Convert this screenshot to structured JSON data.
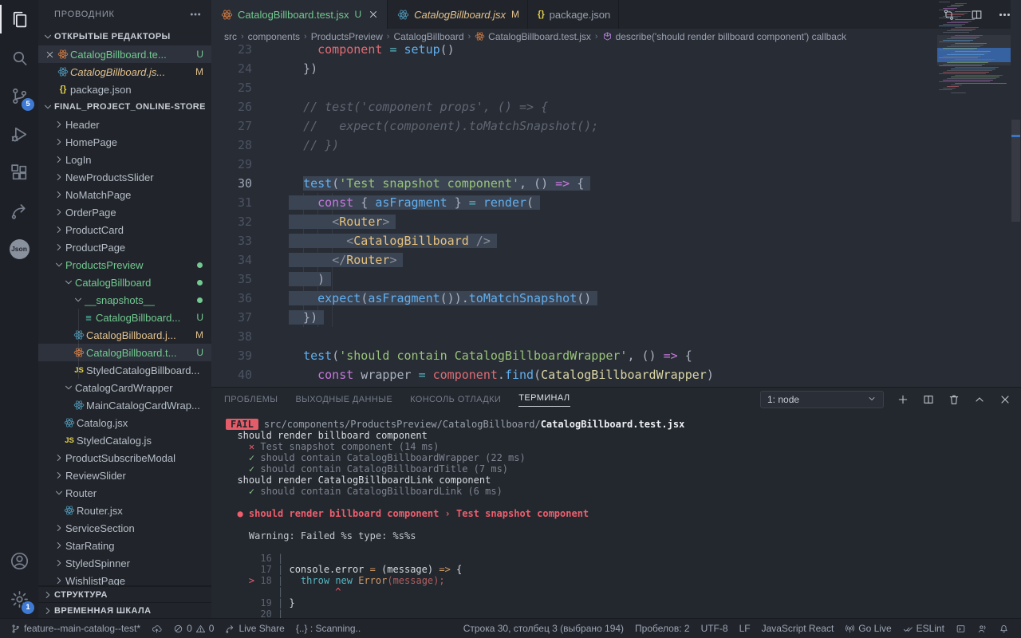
{
  "theme": {
    "accent_blue": "#3e7ad3",
    "git_added_green": "#73c991",
    "git_modified_yellow": "#e2c08d",
    "error_red": "#e45c68",
    "selection": "#3b4453"
  },
  "activity_bar": {
    "items": [
      {
        "name": "explorer",
        "active": true
      },
      {
        "name": "search"
      },
      {
        "name": "source-control",
        "badge": "5"
      },
      {
        "name": "run-debug"
      },
      {
        "name": "extensions"
      },
      {
        "name": "live-share"
      },
      {
        "name": "json-extension",
        "text": "Json"
      }
    ],
    "bottom": [
      {
        "name": "account"
      },
      {
        "name": "settings",
        "badge": "1"
      }
    ]
  },
  "sidebar": {
    "title": "ПРОВОДНИК",
    "sections": {
      "open_editors": "ОТКРЫТЫЕ РЕДАКТОРЫ",
      "workspace": "FINAL_PROJECT_ONLINE-STORE",
      "outline": "СТРУКТУРА",
      "timeline": "ВРЕМЕННАЯ ШКАЛА"
    },
    "open_editors": [
      {
        "label": "CatalogBillboard.te...",
        "icon": "react-orange",
        "color": "green",
        "badge": "U",
        "selected": true,
        "close": true
      },
      {
        "label": "CatalogBillboard.js...",
        "icon": "react-blue",
        "color": "modified",
        "italic": true,
        "badge": "M"
      },
      {
        "label": "package.json",
        "icon": "braces",
        "color": "normal"
      }
    ],
    "tree": [
      {
        "label": "Header",
        "depth": 0,
        "chevron": "right"
      },
      {
        "label": "HomePage",
        "depth": 0,
        "chevron": "right"
      },
      {
        "label": "LogIn",
        "depth": 0,
        "chevron": "right"
      },
      {
        "label": "NewProductsSlider",
        "depth": 0,
        "chevron": "right"
      },
      {
        "label": "NoMatchPage",
        "depth": 0,
        "chevron": "right"
      },
      {
        "label": "OrderPage",
        "depth": 0,
        "chevron": "right"
      },
      {
        "label": "ProductCard",
        "depth": 0,
        "chevron": "right"
      },
      {
        "label": "ProductPage",
        "depth": 0,
        "chevron": "right"
      },
      {
        "label": "ProductsPreview",
        "depth": 0,
        "chevron": "down",
        "color": "green",
        "dot": true
      },
      {
        "label": "CatalogBillboard",
        "depth": 1,
        "chevron": "down",
        "color": "green",
        "dot": true
      },
      {
        "label": "__snapshots__",
        "depth": 2,
        "chevron": "down",
        "color": "green",
        "dot": true
      },
      {
        "label": "CatalogBillboard...",
        "depth": 3,
        "icon": "snap",
        "color": "green",
        "badge": "U"
      },
      {
        "label": "CatalogBillboard.j...",
        "depth": 2,
        "icon": "react-blue",
        "color": "modified",
        "badge": "M"
      },
      {
        "label": "CatalogBillboard.t...",
        "depth": 2,
        "icon": "react-orange",
        "color": "green",
        "badge": "U",
        "selected": true
      },
      {
        "label": "StyledCatalogBillboard...",
        "depth": 2,
        "icon": "js"
      },
      {
        "label": "CatalogCardWrapper",
        "depth": 1,
        "chevron": "down"
      },
      {
        "label": "MainCatalogCardWrap...",
        "depth": 2,
        "icon": "react-blue"
      },
      {
        "label": "Catalog.jsx",
        "depth": 1,
        "icon": "react-blue"
      },
      {
        "label": "StyledCatalog.js",
        "depth": 1,
        "icon": "js"
      },
      {
        "label": "ProductSubscribeModal",
        "depth": 0,
        "chevron": "right"
      },
      {
        "label": "ReviewSlider",
        "depth": 0,
        "chevron": "right"
      },
      {
        "label": "Router",
        "depth": 0,
        "chevron": "down"
      },
      {
        "label": "Router.jsx",
        "depth": 1,
        "icon": "react-blue"
      },
      {
        "label": "ServiceSection",
        "depth": 0,
        "chevron": "right"
      },
      {
        "label": "StarRating",
        "depth": 0,
        "chevron": "right"
      },
      {
        "label": "StyledSpinner",
        "depth": 0,
        "chevron": "right"
      },
      {
        "label": "WishlistPage",
        "depth": 0,
        "chevron": "right"
      }
    ]
  },
  "tabs": [
    {
      "label": "CatalogBillboard.test.jsx",
      "icon": "react-orange",
      "color": "#73c991",
      "badge": "U",
      "badge_color": "#73c991",
      "active": true,
      "close": true
    },
    {
      "label": "CatalogBillboard.jsx",
      "icon": "react-blue",
      "color": "#e2c08d",
      "badge": "M",
      "badge_color": "#e2c08d",
      "italic": true
    },
    {
      "label": "package.json",
      "icon": "braces",
      "color": "#99a0ad"
    }
  ],
  "editor_actions": [
    "git-compare",
    "split-editor",
    "more"
  ],
  "breadcrumbs": {
    "path": [
      "src",
      "components",
      "ProductsPreview",
      "CatalogBillboard"
    ],
    "file": {
      "icon": "react-orange",
      "label": "CatalogBillboard.test.jsx"
    },
    "symbol": {
      "icon": "symbol-namespace",
      "label": "describe('should render billboard component') callback"
    }
  },
  "editor": {
    "cursor_line": 30,
    "lines": [
      {
        "n": 23,
        "tokens": [
          [
            "    ",
            "d"
          ],
          [
            "component",
            "v"
          ],
          [
            " ",
            "d"
          ],
          [
            "=",
            "o"
          ],
          [
            " ",
            "d"
          ],
          [
            "setup",
            "f"
          ],
          [
            "()",
            "d"
          ]
        ]
      },
      {
        "n": 24,
        "tokens": [
          [
            "  })",
            "d"
          ]
        ]
      },
      {
        "n": 25,
        "tokens": []
      },
      {
        "n": 26,
        "tokens": [
          [
            "  ",
            "d"
          ],
          [
            "// test('component props', () => {",
            "c"
          ]
        ]
      },
      {
        "n": 27,
        "tokens": [
          [
            "  ",
            "d"
          ],
          [
            "//   expect(component).toMatchSnapshot();",
            "c"
          ]
        ]
      },
      {
        "n": 28,
        "tokens": [
          [
            "  ",
            "d"
          ],
          [
            "// })",
            "c"
          ]
        ]
      },
      {
        "n": 29,
        "tokens": []
      },
      {
        "n": 30,
        "sel": 2,
        "cursor": true,
        "tokens": [
          [
            "  ",
            "d"
          ],
          [
            "test",
            "f"
          ],
          [
            "(",
            "d"
          ],
          [
            "'Test snapshot component'",
            "s"
          ],
          [
            ", () ",
            "d"
          ],
          [
            "=>",
            "k"
          ],
          [
            " {",
            "d"
          ]
        ]
      },
      {
        "n": 31,
        "sel": 0,
        "tokens": [
          [
            "    ",
            "d"
          ],
          [
            "const",
            "k"
          ],
          [
            " { ",
            "d"
          ],
          [
            "asFragment",
            "f"
          ],
          [
            " } ",
            "d"
          ],
          [
            "=",
            "o"
          ],
          [
            " ",
            "d"
          ],
          [
            "render",
            "f"
          ],
          [
            "(",
            "d"
          ]
        ]
      },
      {
        "n": 32,
        "sel": 0,
        "tokens": [
          [
            "      ",
            "d"
          ],
          [
            "<",
            "p"
          ],
          [
            "Router",
            "t"
          ],
          [
            ">",
            "p"
          ]
        ]
      },
      {
        "n": 33,
        "sel": 0,
        "tokens": [
          [
            "        ",
            "d"
          ],
          [
            "<",
            "p"
          ],
          [
            "CatalogBillboard",
            "t"
          ],
          [
            " />",
            "p"
          ]
        ]
      },
      {
        "n": 34,
        "sel": 0,
        "tokens": [
          [
            "      ",
            "d"
          ],
          [
            "</",
            "p"
          ],
          [
            "Router",
            "t"
          ],
          [
            ">",
            "p"
          ]
        ]
      },
      {
        "n": 35,
        "sel": 0,
        "tokens": [
          [
            "    )",
            "d"
          ]
        ]
      },
      {
        "n": 36,
        "sel": 0,
        "tokens": [
          [
            "    ",
            "d"
          ],
          [
            "expect",
            "f"
          ],
          [
            "(",
            "d"
          ],
          [
            "asFragment",
            "f"
          ],
          [
            "()).",
            "d"
          ],
          [
            "toMatchSnapshot",
            "f"
          ],
          [
            "()",
            "d"
          ]
        ]
      },
      {
        "n": 37,
        "sel": 0,
        "tokens": [
          [
            "  })",
            "d"
          ]
        ]
      },
      {
        "n": 38,
        "tokens": []
      },
      {
        "n": 39,
        "tokens": [
          [
            "  ",
            "d"
          ],
          [
            "test",
            "f"
          ],
          [
            "(",
            "d"
          ],
          [
            "'should contain CatalogBillboardWrapper'",
            "s"
          ],
          [
            ", () ",
            "d"
          ],
          [
            "=>",
            "k"
          ],
          [
            " {",
            "d"
          ]
        ]
      },
      {
        "n": 40,
        "tokens": [
          [
            "    ",
            "d"
          ],
          [
            "const",
            "k"
          ],
          [
            " wrapper ",
            "d"
          ],
          [
            "=",
            "o"
          ],
          [
            " ",
            "d"
          ],
          [
            "component",
            "v"
          ],
          [
            ".",
            "d"
          ],
          [
            "find",
            "f"
          ],
          [
            "(",
            "d"
          ],
          [
            "CatalogBillboardWrapper",
            "n"
          ],
          [
            ")",
            "d"
          ]
        ]
      }
    ]
  },
  "minimap": {
    "total_rows": 58,
    "selection_rows": [
      29,
      37
    ],
    "viewport_rows": [
      21,
      39
    ]
  },
  "panel": {
    "tabs": [
      "ПРОБЛЕМЫ",
      "ВЫХОДНЫЕ ДАННЫЕ",
      "КОНСОЛЬ ОТЛАДКИ",
      "ТЕРМИНАЛ"
    ],
    "active_tab": "ТЕРМИНАЛ",
    "dropdown": "1: node",
    "actions": [
      "plus",
      "split-editor",
      "trash",
      "chevron-up",
      "close"
    ],
    "lines": [
      {
        "tokens": [
          [
            "FAIL",
            "badge"
          ],
          [
            "src/components/ProductsPreview/CatalogBillboard/",
            "g"
          ],
          [
            "CatalogBillboard.test.jsx",
            "b"
          ]
        ]
      },
      {
        "tokens": [
          [
            "  should render billboard component",
            "w"
          ]
        ]
      },
      {
        "tokens": [
          [
            "    ",
            "w"
          ],
          [
            "✕",
            "r"
          ],
          [
            " Test snapshot component (14 ms)",
            "dim"
          ]
        ]
      },
      {
        "tokens": [
          [
            "    ",
            "w"
          ],
          [
            "✓",
            "gr"
          ],
          [
            " should contain CatalogBillboardWrapper (22 ms)",
            "dim"
          ]
        ]
      },
      {
        "tokens": [
          [
            "    ",
            "w"
          ],
          [
            "✓",
            "gr"
          ],
          [
            " should contain CatalogBillboardTitle (7 ms)",
            "dim"
          ]
        ]
      },
      {
        "tokens": [
          [
            "  should render CatalogBillboardLink component",
            "w"
          ]
        ]
      },
      {
        "tokens": [
          [
            "    ",
            "w"
          ],
          [
            "✓",
            "gr"
          ],
          [
            " should contain CatalogBillboardLink (6 ms)",
            "dim"
          ]
        ]
      },
      {
        "tokens": []
      },
      {
        "tokens": [
          [
            "  ",
            "w"
          ],
          [
            "● should render billboard component › Test snapshot component",
            "rb"
          ]
        ]
      },
      {
        "tokens": []
      },
      {
        "tokens": [
          [
            "    Warning: Failed %s type: %s%s",
            "w2"
          ]
        ]
      },
      {
        "tokens": []
      },
      {
        "tokens": [
          [
            "      16 |",
            "num"
          ]
        ]
      },
      {
        "tokens": [
          [
            "      17 |",
            "num"
          ],
          [
            " console.error ",
            "w"
          ],
          [
            "=",
            "or"
          ],
          [
            " (message) ",
            "w"
          ],
          [
            "=>",
            "or"
          ],
          [
            " {",
            "w"
          ]
        ]
      },
      {
        "tokens": [
          [
            "    ",
            "w"
          ],
          [
            "> ",
            "r"
          ],
          [
            "18 |",
            "num"
          ],
          [
            "   ",
            "w"
          ],
          [
            "throw",
            "cy"
          ],
          [
            " ",
            "er"
          ],
          [
            "new",
            "cy"
          ],
          [
            " ",
            "er"
          ],
          [
            "Error",
            "or"
          ],
          [
            "(message);",
            "er"
          ]
        ]
      },
      {
        "tokens": [
          [
            "         |",
            "num"
          ],
          [
            "         ",
            "w"
          ],
          [
            "^",
            "r"
          ]
        ]
      },
      {
        "tokens": [
          [
            "      19 |",
            "num"
          ],
          [
            " }",
            "w"
          ]
        ]
      },
      {
        "tokens": [
          [
            "      20 |",
            "num"
          ]
        ]
      }
    ]
  },
  "status_bar": {
    "left": [
      {
        "name": "git-branch",
        "icon": "branch",
        "label": "feature--main-catalog--test*"
      },
      {
        "name": "publish-changes",
        "icon": "cloud-upload",
        "label": ""
      },
      {
        "name": "problems",
        "icon": "circle-slash",
        "label": "0",
        "icon2": "warning",
        "label2": "0"
      },
      {
        "name": "live-share",
        "icon": "live-share",
        "label": "Live Share"
      },
      {
        "name": "scanning",
        "label": "{..} : Scanning.."
      }
    ],
    "right": [
      {
        "name": "cursor-position",
        "label": "Строка 30, столбец 3 (выбрано 194)"
      },
      {
        "name": "indentation",
        "label": "Пробелов: 2"
      },
      {
        "name": "encoding",
        "label": "UTF-8"
      },
      {
        "name": "eol",
        "label": "LF"
      },
      {
        "name": "language-mode",
        "label": "JavaScript React"
      },
      {
        "name": "go-live",
        "icon": "broadcast",
        "label": "Go Live"
      },
      {
        "name": "eslint",
        "icon": "check-double",
        "label": "ESLint"
      },
      {
        "name": "terminal-panel",
        "icon": "panel-box",
        "label": ""
      },
      {
        "name": "contacts",
        "icon": "person-wave",
        "label": ""
      },
      {
        "name": "notifications",
        "icon": "bell",
        "label": ""
      }
    ]
  }
}
